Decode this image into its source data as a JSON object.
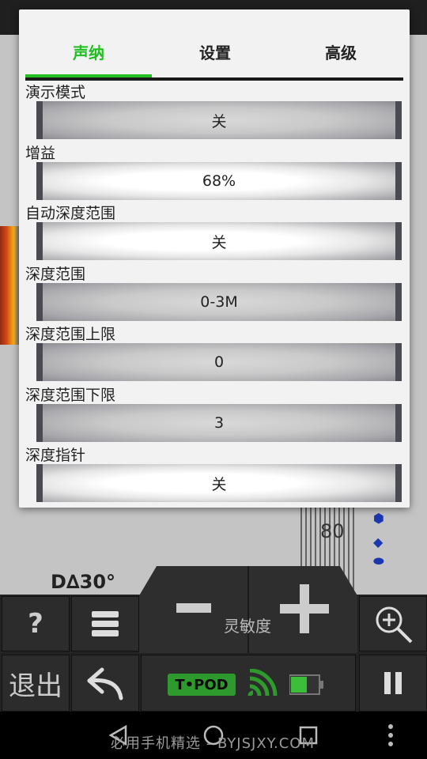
{
  "tabs": [
    {
      "label": "声纳",
      "active": true
    },
    {
      "label": "设置",
      "active": false
    },
    {
      "label": "高级",
      "active": false
    }
  ],
  "settings": [
    {
      "label": "演示模式",
      "value": "关"
    },
    {
      "label": "增益",
      "value": "68%"
    },
    {
      "label": "自动深度范围",
      "value": "关"
    },
    {
      "label": "深度范围",
      "value": "0-3M"
    },
    {
      "label": "深度范围上限",
      "value": "0"
    },
    {
      "label": "深度范围下限",
      "value": "3"
    },
    {
      "label": "深度指针",
      "value": "关"
    }
  ],
  "background": {
    "scale_number": "80",
    "scale_label": "D∆30°"
  },
  "controls": {
    "help_label": "?",
    "exit_label": "退出",
    "sensitivity_label": "灵敏度",
    "device_label": "T•POD"
  },
  "watermark": "必用手机精选 - BYJSJXY.COM",
  "colors": {
    "accent": "#21c021"
  }
}
